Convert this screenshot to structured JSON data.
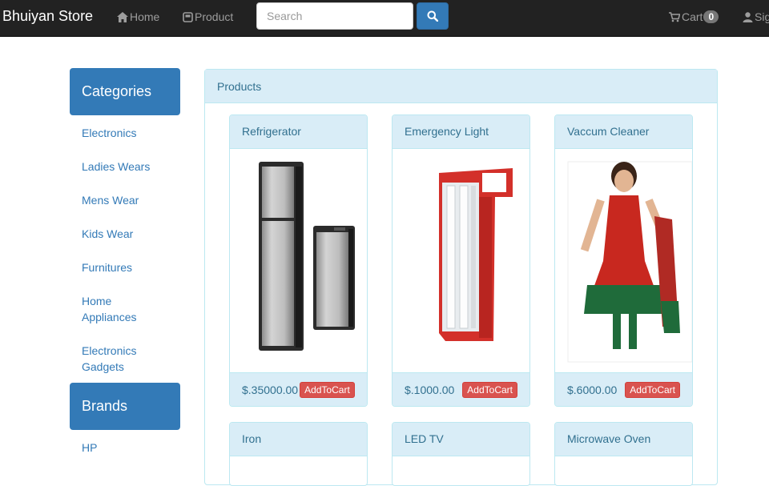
{
  "navbar": {
    "brand": "Bhuiyan Store",
    "home_label": "Home",
    "product_label": "Product",
    "search_placeholder": "Search",
    "cart_label": "Cart",
    "cart_count": "0",
    "signin_label": "Sig"
  },
  "sidebar": {
    "categories_title": "Categories",
    "categories": [
      "Electronics",
      "Ladies Wears",
      "Mens Wear",
      "Kids Wear",
      "Furnitures",
      "Home Appliances",
      "Electronics Gadgets"
    ],
    "brands_title": "Brands",
    "brands": [
      "HP"
    ]
  },
  "products": {
    "panel_title": "Products",
    "add_label": "AddToCart",
    "items": [
      {
        "name": "Refrigerator",
        "price": "$.35000.00"
      },
      {
        "name": "Emergency Light",
        "price": "$.1000.00"
      },
      {
        "name": "Vaccum Cleaner",
        "price": "$.6000.00"
      },
      {
        "name": "Iron"
      },
      {
        "name": "LED TV"
      },
      {
        "name": "Microwave Oven"
      }
    ]
  },
  "colors": {
    "navbar": "#222222",
    "primary": "#337ab7",
    "panel_info": "#d9edf7",
    "danger": "#d9534f"
  }
}
